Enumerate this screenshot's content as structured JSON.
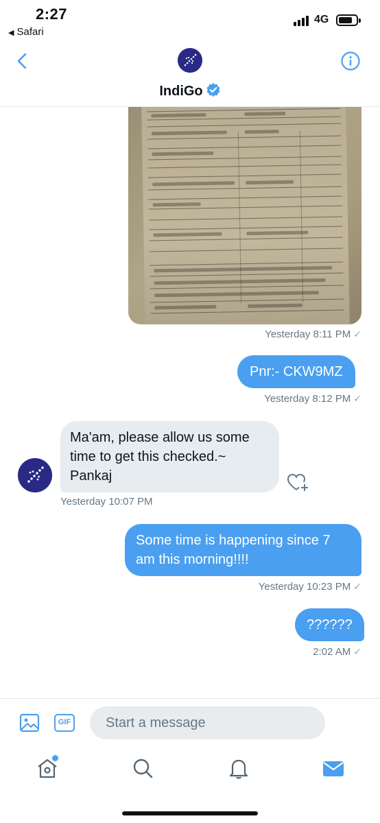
{
  "status_bar": {
    "time": "2:27",
    "back_app": "Safari",
    "network": "4G"
  },
  "header": {
    "name": "IndiGo",
    "verified": true
  },
  "messages": [
    {
      "kind": "image",
      "direction": "outgoing",
      "meta": "Yesterday 8:11 PM",
      "read_icon": "check-icon"
    },
    {
      "kind": "text",
      "direction": "outgoing",
      "text": "Pnr:- CKW9MZ",
      "meta": "Yesterday 8:12 PM",
      "read_icon": "check-icon"
    },
    {
      "kind": "text",
      "direction": "incoming",
      "text": "Ma'am, please allow us some time to get this checked.~ Pankaj",
      "meta": "Yesterday 10:07 PM"
    },
    {
      "kind": "text",
      "direction": "outgoing",
      "text": "Some time is happening since 7 am this morning!!!!",
      "meta": "Yesterday 10:23 PM",
      "read_icon": "check-icon"
    },
    {
      "kind": "text",
      "direction": "outgoing",
      "text": "??????",
      "meta": "2:02 AM",
      "read_icon": "check-icon"
    }
  ],
  "composer": {
    "placeholder": "Start a message",
    "value": "",
    "gif_label": "GIF"
  },
  "tabbar": {
    "items": [
      "home-icon",
      "search-icon",
      "notifications-icon",
      "messages-icon"
    ],
    "active": "messages-icon"
  },
  "colors": {
    "accent": "#4a9ff0",
    "incoming_bubble": "#e7ecf0",
    "outgoing_bubble": "#4a9ff0",
    "brand_avatar": "#2a2a86",
    "meta_text": "#657786"
  }
}
